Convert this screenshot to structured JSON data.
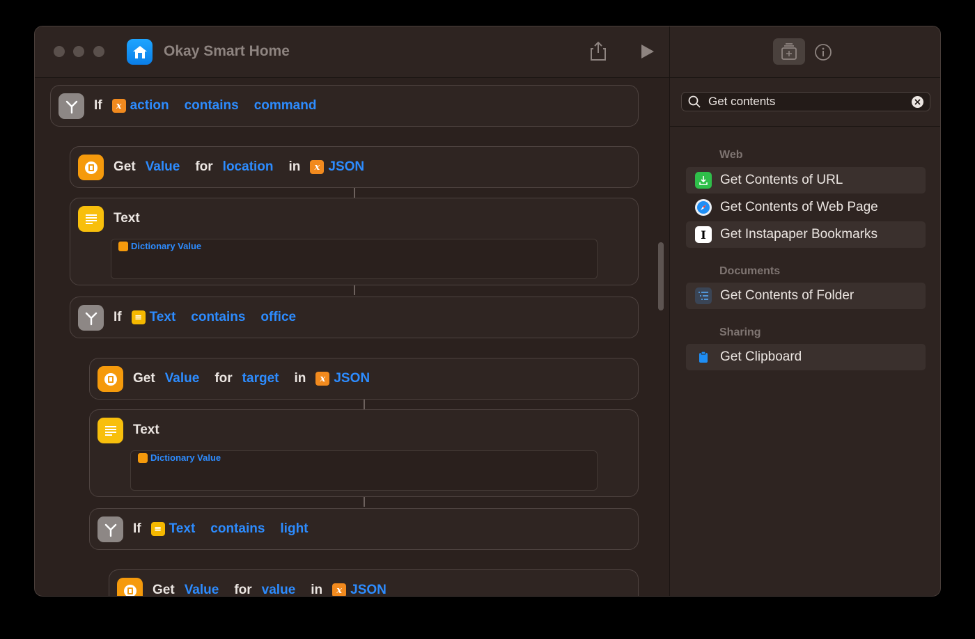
{
  "window": {
    "title": "Okay Smart Home"
  },
  "editor": {
    "blocks": [
      {
        "kind": "if",
        "keyword": "If",
        "var": "action",
        "op": "contains",
        "val": "command"
      },
      {
        "kind": "get",
        "keyword": "Get",
        "a": "Value",
        "for": "for",
        "key": "location",
        "in": "in",
        "src": "JSON"
      },
      {
        "kind": "text",
        "title": "Text",
        "token": "Dictionary Value"
      },
      {
        "kind": "if",
        "keyword": "If",
        "var": "Text",
        "op": "contains",
        "val": "office"
      },
      {
        "kind": "get",
        "keyword": "Get",
        "a": "Value",
        "for": "for",
        "key": "target",
        "in": "in",
        "src": "JSON"
      },
      {
        "kind": "text",
        "title": "Text",
        "token": "Dictionary Value"
      },
      {
        "kind": "if",
        "keyword": "If",
        "var": "Text",
        "op": "contains",
        "val": "light"
      },
      {
        "kind": "get",
        "keyword": "Get",
        "a": "Value",
        "for": "for",
        "key": "value",
        "in": "in",
        "src": "JSON"
      }
    ]
  },
  "sidebar": {
    "search": {
      "value": "Get contents"
    },
    "sections": [
      {
        "title": "Web",
        "items": [
          "Get Contents of URL",
          "Get Contents of Web Page",
          "Get Instapaper Bookmarks"
        ]
      },
      {
        "title": "Documents",
        "items": [
          "Get Contents of Folder"
        ]
      },
      {
        "title": "Sharing",
        "items": [
          "Get Clipboard"
        ]
      }
    ]
  },
  "colors": {
    "accent": "#2d8cff",
    "variable": "#f28a1e",
    "dictionary": "#f59a0c",
    "text_action": "#f8bf0c"
  }
}
